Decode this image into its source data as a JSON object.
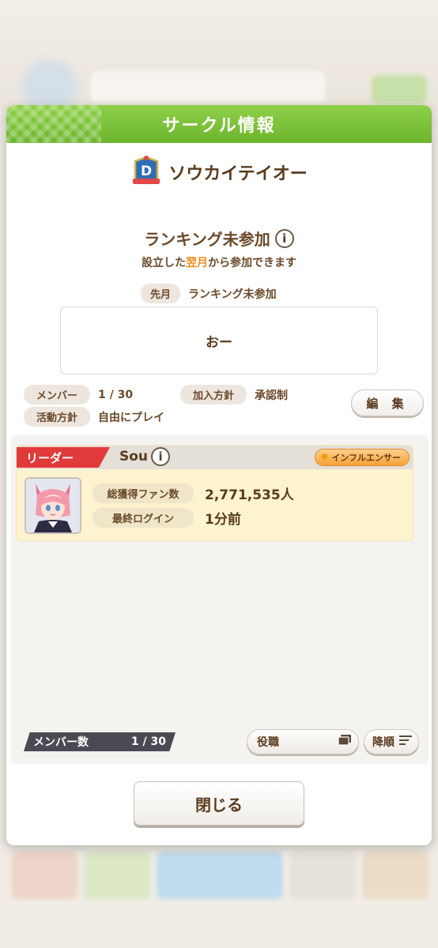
{
  "dialog": {
    "title": "サークル情報"
  },
  "club": {
    "name": "ソウカイテイオー",
    "rank_letter": "D"
  },
  "ranking": {
    "status": "ランキング未参加",
    "note_before": "設立した",
    "note_highlight": "翌月",
    "note_after": "から参加できます",
    "last_month_label": "先月",
    "last_month_value": "ランキング未参加"
  },
  "message": "おー",
  "meta": {
    "members_label": "メンバー",
    "members_value": "1 / 30",
    "join_policy_label": "加入方針",
    "join_policy_value": "承認制",
    "activity_label": "活動方針",
    "activity_value": "自由にプレイ",
    "edit_label": "編 集"
  },
  "member_card": {
    "role_tag": "リーダー",
    "name": "Sou",
    "badge": "インフルエンサー",
    "fans_label": "総獲得ファン数",
    "fans_value": "2,771,535人",
    "login_label": "最終ログイン",
    "login_value": "1分前"
  },
  "footer": {
    "member_count_label": "メンバー数",
    "member_count_value": "1 / 30",
    "role_sort_label": "役職",
    "order_label": "降順",
    "close_label": "閉じる"
  },
  "colors": {
    "header_green": "#7cc23a",
    "highlight_orange": "#f08a1c",
    "leader_red": "#e13a3a",
    "card_yellow": "#fdf3cf"
  }
}
